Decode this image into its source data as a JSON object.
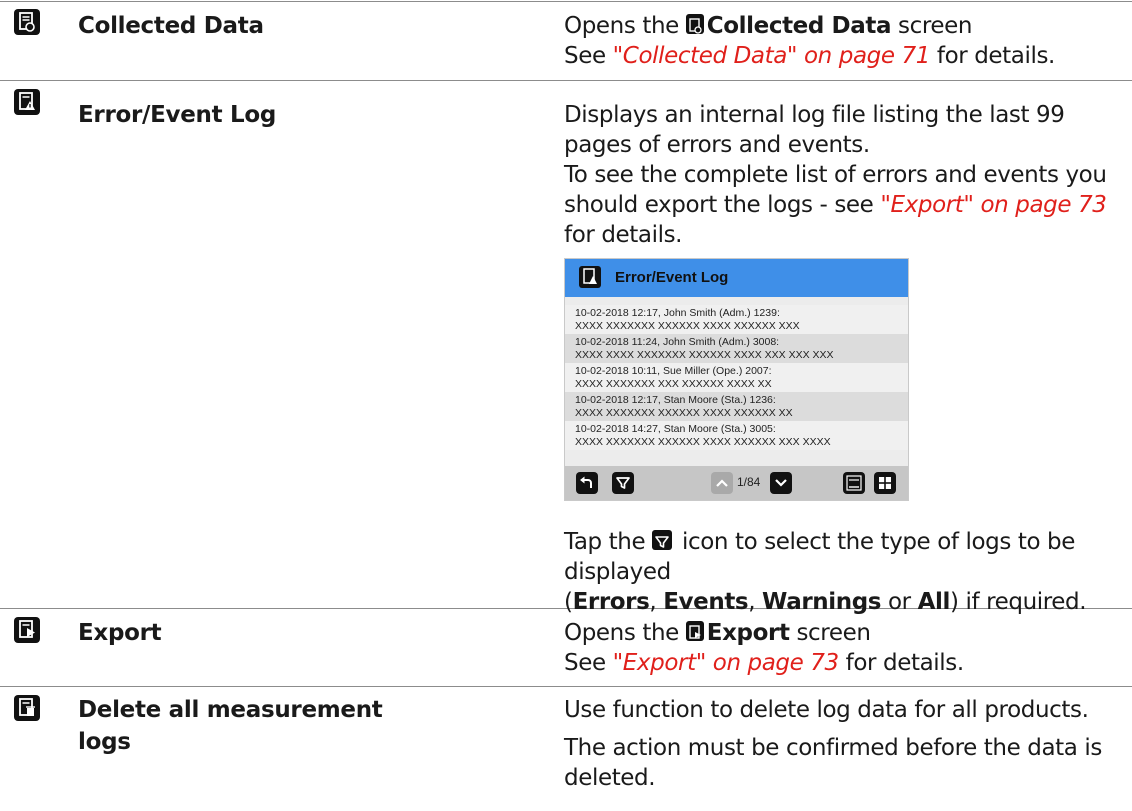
{
  "rows": [
    {
      "icon": "collected-data-icon",
      "label": "Collected Data",
      "desc_pre": "Opens the ",
      "desc_bold": "Collected Data",
      "desc_post": " screen",
      "see_pre": "See ",
      "see_ref": "\"Collected Data\" on page 71",
      "see_post": " for details."
    },
    {
      "icon": "error-event-log-icon",
      "label": "Error/Event Log",
      "para1": "Displays an internal log file listing the last 99 pages of errors and events.",
      "para2_pre": "To see the complete list of errors and events you should export the logs - see ",
      "para2_ref": "\"Export\" on page 73",
      "para2_post": " for details.",
      "tap_pre": "Tap the ",
      "tap_post": " icon to select the type of logs to be displayed",
      "opt_open": "(",
      "opt1": "Errors",
      "sep1": ", ",
      "opt2": "Events",
      "sep2": ", ",
      "opt3": "Warnings",
      "or": " or ",
      "opt4": "All",
      "opt_close": ") if required."
    },
    {
      "icon": "export-icon",
      "label": "Export",
      "desc_pre": "Opens the ",
      "desc_bold": "Export",
      "desc_post": " screen",
      "see_pre": "See ",
      "see_ref": "\"Export\" on page 73",
      "see_post": " for details."
    },
    {
      "icon": "delete-logs-icon",
      "label_line1": "Delete all measurement",
      "label_line2": "logs",
      "para1": "Use function to delete log data for all products.",
      "para2": "The action must be confirmed before the data is deleted."
    }
  ],
  "screen": {
    "title": "Error/Event Log",
    "header_color": "#3f8fe8",
    "entries": [
      {
        "line1": "10-02-2018 12:17,  John Smith (Adm.) 1239:",
        "line2": "XXXX XXXXXXX XXXXXX XXXX XXXXXX XXX"
      },
      {
        "line1": "10-02-2018 11:24,  John Smith (Adm.) 3008:",
        "line2": "XXXX XXXX XXXXXXX XXXXXX XXXX XXX XXX XXX"
      },
      {
        "line1": "10-02-2018 10:11,  Sue Miller (Ope.) 2007:",
        "line2": "XXXX XXXXXXX XXX XXXXXX XXXX XX"
      },
      {
        "line1": "10-02-2018 12:17,  Stan Moore (Sta.) 1236:",
        "line2": "XXXX XXXXXXX XXXXXX XXXX XXXXXX XX"
      },
      {
        "line1": "10-02-2018 14:27,  Stan Moore (Sta.) 3005:",
        "line2": "XXXX XXXXXXX XXXXXX XXXX XXXXXX XXX XXXX"
      }
    ],
    "page_indicator": "1/84",
    "footer_icons": [
      "back-icon",
      "filter-icon",
      "page-up-icon",
      "page-down-icon",
      "numeric-keypad-icon",
      "grid-icon"
    ]
  },
  "colors": {
    "link": "#e0201b",
    "rule": "#8c8c8c"
  }
}
